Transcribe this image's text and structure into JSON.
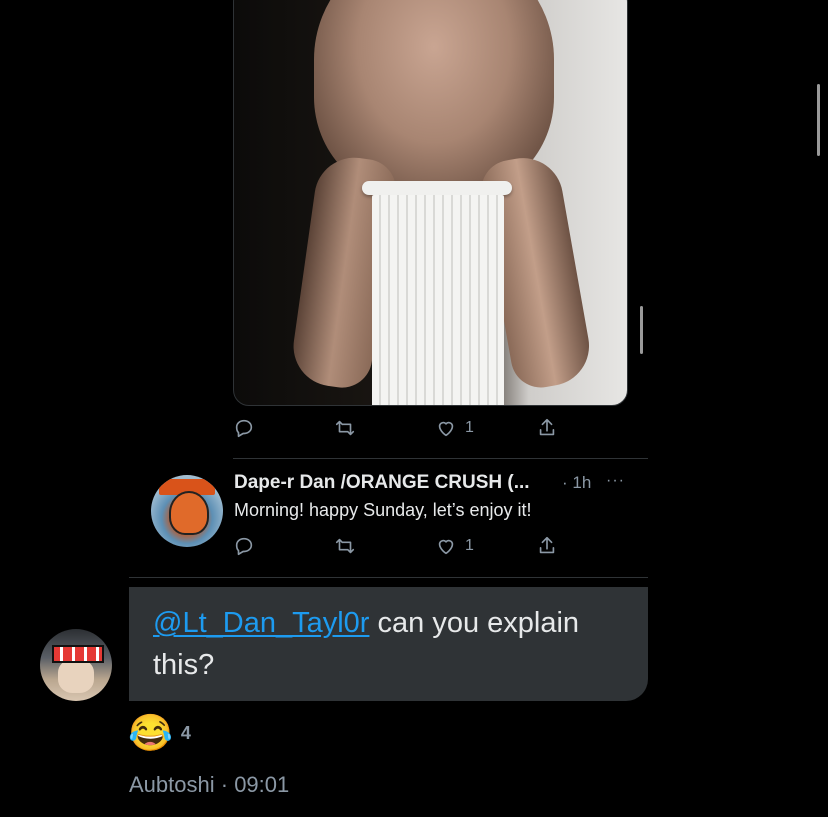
{
  "quoted_tweet_top": {
    "actions": {
      "reply_count": "",
      "retweet_count": "",
      "like_count": "1",
      "share_label": ""
    }
  },
  "reply_tweet": {
    "display_name": "Dape-r Dan /ORANGE CRUSH (...",
    "time": "· 1h",
    "more": "···",
    "text": "Morning! happy Sunday, let’s enjoy it!",
    "actions": {
      "reply_count": "",
      "retweet_count": "",
      "like_count": "1"
    }
  },
  "message": {
    "mention": "@Lt_Dan_Tayl0r",
    "text": " can you explain this?",
    "reaction": {
      "emoji": "😂",
      "count": "4"
    },
    "sender": "Aubtoshi",
    "time": "· 09:01"
  },
  "icons": {
    "reply": "reply-icon",
    "retweet": "retweet-icon",
    "like": "heart-icon",
    "share": "share-icon",
    "more": "more-icon"
  },
  "colors": {
    "background": "#000000",
    "bubble": "#2f3336",
    "mention": "#1d9bf0",
    "secondary_text": "#8b98a5",
    "divider": "#2f3336"
  }
}
